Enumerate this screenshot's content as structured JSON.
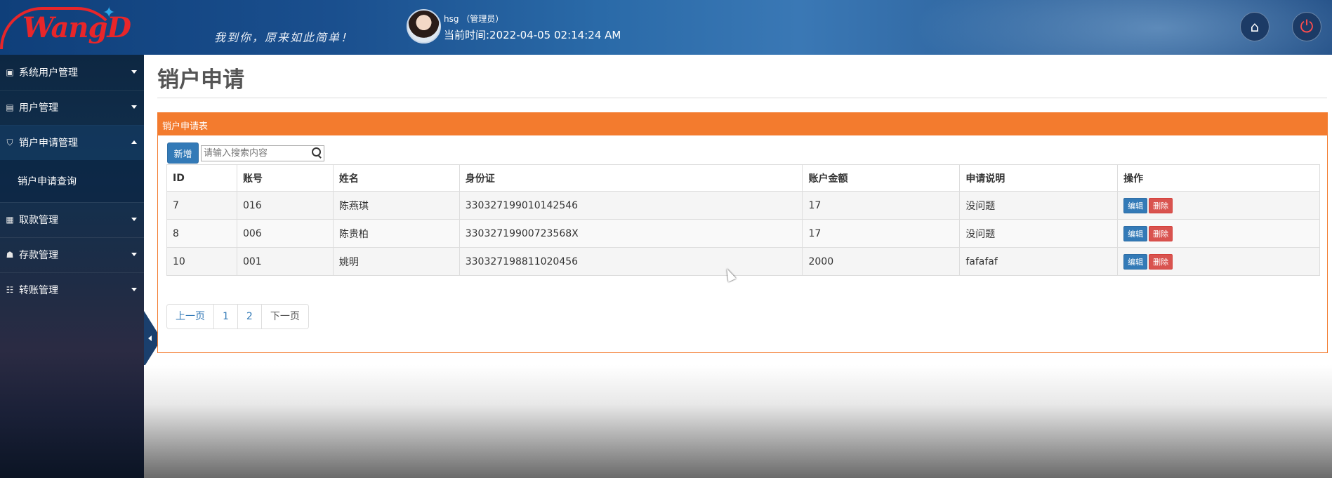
{
  "header": {
    "logo_text": "WangD",
    "slogan": "我到你，原来如此简单！",
    "user_name": "hsg （管理员）",
    "current_time": "当前时间:2022-04-05 02:14:24 AM",
    "home_icon": "home-icon",
    "power_icon": "power-icon"
  },
  "sidebar": {
    "items": [
      {
        "label": "系统用户管理",
        "icon": "id-card-icon"
      },
      {
        "label": "用户管理",
        "icon": "user-card-icon"
      },
      {
        "label": "销户申请管理",
        "icon": "shield-icon"
      },
      {
        "label": "取款管理",
        "icon": "file-icon"
      },
      {
        "label": "存款管理",
        "icon": "users-icon"
      },
      {
        "label": "转账管理",
        "icon": "sitemap-icon"
      }
    ],
    "sub_items": [
      {
        "label": "销户申请查询"
      }
    ]
  },
  "main": {
    "page_title": "销户申请",
    "panel_title": "销户申请表",
    "add_button": "新增",
    "search_placeholder": "请输入搜索内容",
    "table": {
      "headers": [
        "ID",
        "账号",
        "姓名",
        "身份证",
        "账户金额",
        "申请说明",
        "操作"
      ],
      "rows": [
        [
          "7",
          "016",
          "陈燕琪",
          "330327199010142546",
          "17",
          "没问题"
        ],
        [
          "8",
          "006",
          "陈贵柏",
          "33032719900723568X",
          "17",
          "没问题"
        ],
        [
          "10",
          "001",
          "姚明",
          "330327198811020456",
          "2000",
          "fafafaf"
        ]
      ],
      "edit_label": "编辑",
      "delete_label": "删除"
    },
    "pager": {
      "prev": "上一页",
      "pages": [
        "1",
        "2"
      ],
      "next": "下一页"
    }
  },
  "colors": {
    "accent_orange": "#f37b2e",
    "primary_blue": "#337ab7",
    "danger_red": "#d9534f"
  }
}
